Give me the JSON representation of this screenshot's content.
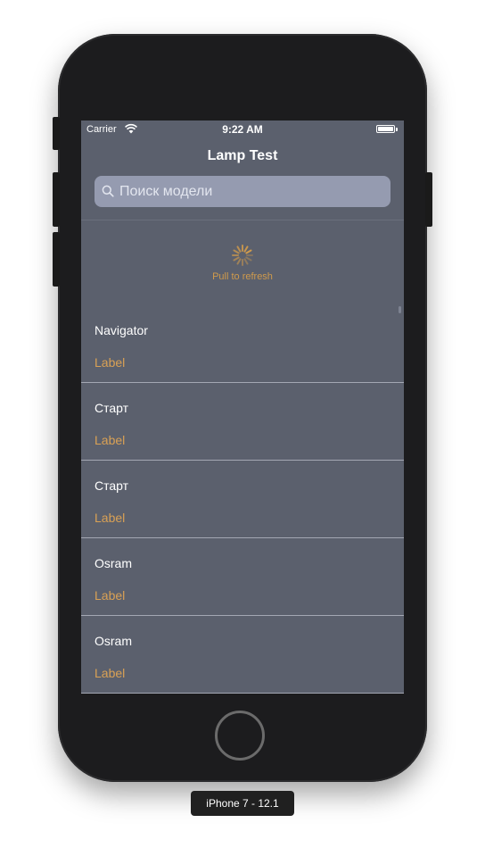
{
  "status_bar": {
    "carrier": "Carrier",
    "time": "9:22 AM",
    "wifi_icon": "wifi-icon",
    "battery_icon": "battery-icon"
  },
  "nav": {
    "title": "Lamp Test"
  },
  "search": {
    "placeholder": "Поиск модели",
    "value": "",
    "icon": "search-icon"
  },
  "refresh": {
    "label": "Pull to refresh",
    "icon": "activity-spinner-icon",
    "color": "#cf9a4c"
  },
  "list": {
    "items": [
      {
        "title": "Navigator",
        "subtitle": "Label"
      },
      {
        "title": "Старт",
        "subtitle": "Label"
      },
      {
        "title": "Старт",
        "subtitle": "Label"
      },
      {
        "title": "Osram",
        "subtitle": "Label"
      },
      {
        "title": "Osram",
        "subtitle": "Label"
      }
    ]
  },
  "device": {
    "label": "iPhone 7 - 12.1"
  },
  "colors": {
    "background": "#5b606d",
    "accent": "#d9a155",
    "search_field": "#959bb0"
  }
}
